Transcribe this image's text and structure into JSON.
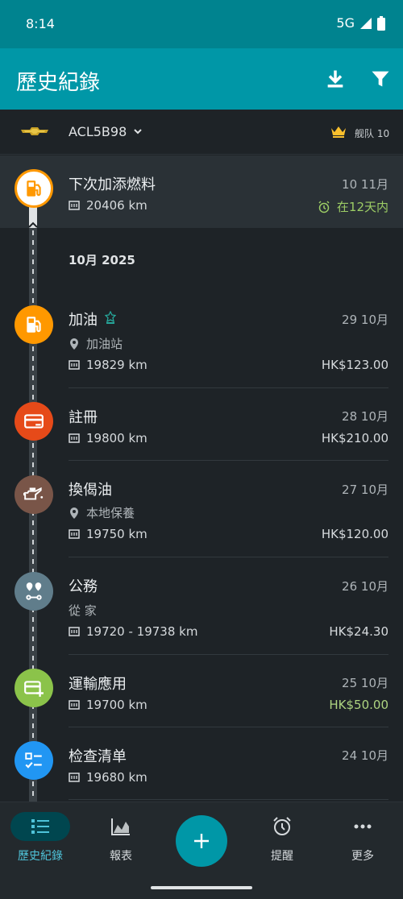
{
  "status_bar": {
    "time": "8:14",
    "network": "5G"
  },
  "app_bar": {
    "title": "歷史紀錄"
  },
  "vehicle": {
    "plate": "ACL5B98",
    "fleet_label": "舰队 10"
  },
  "upcoming": {
    "title": "下次加添燃料",
    "date": "10 11月",
    "odometer": "20406 km",
    "reminder": "在12天内"
  },
  "month_header": "10月 2025",
  "entries": [
    {
      "title": "加油",
      "date": "29 10月",
      "location": "加油站",
      "odometer": "19829 km",
      "amount": "HK$123.00"
    },
    {
      "title": "註冊",
      "date": "28 10月",
      "odometer": "19800 km",
      "amount": "HK$210.00"
    },
    {
      "title": "換偈油",
      "date": "27 10月",
      "location": "本地保養",
      "odometer": "19750 km",
      "amount": "HK$120.00"
    },
    {
      "title": "公務",
      "date": "26 10月",
      "route": "從 家",
      "odometer": "19720 - 19738 km",
      "amount": "HK$24.30"
    },
    {
      "title": "運輸應用",
      "date": "25 10月",
      "odometer": "19700 km",
      "amount": "HK$50.00"
    },
    {
      "title": "检查清单",
      "date": "24 10月",
      "odometer": "19680 km"
    }
  ],
  "bottom_nav": {
    "history": "歷史紀錄",
    "reports": "報表",
    "reminders": "提醒",
    "more": "更多"
  },
  "colors": {
    "accent": "#0097a7",
    "fuel": "#ff9800",
    "registration": "#e64a19",
    "oil_change": "#795548",
    "trip": "#607d8b",
    "income": "#8bc34a",
    "checklist": "#2196f3",
    "positive_amount": "#aed581",
    "reminder_green": "#9ccc65"
  }
}
